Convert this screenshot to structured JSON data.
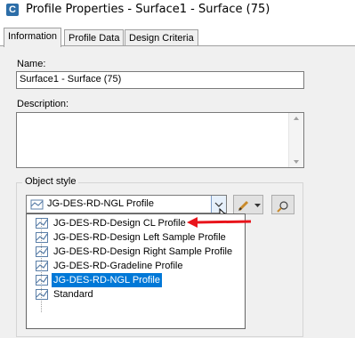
{
  "window": {
    "title": "Profile Properties - Surface1 - Surface (75)",
    "app_icon": "C"
  },
  "tabs": [
    {
      "label": "Information",
      "active": true
    },
    {
      "label": "Profile Data",
      "active": false
    },
    {
      "label": "Design Criteria",
      "active": false
    }
  ],
  "form": {
    "name_label": "Name:",
    "name_value": "Surface1 - Surface (75)",
    "description_label": "Description:",
    "description_value": "",
    "object_style_label": "Object style",
    "object_style_value": "JG-DES-RD-NGL Profile"
  },
  "dropdown": {
    "items": [
      "JG-DES-RD-Design CL Profile",
      "JG-DES-RD-Design Left Sample Profile",
      "JG-DES-RD-Design Right Sample Profile",
      "JG-DES-RD-Gradeline Profile",
      "JG-DES-RD-NGL Profile",
      "Standard"
    ],
    "selected": "JG-DES-RD-NGL Profile"
  },
  "colors": {
    "accent": "#0078d7",
    "annotation_arrow": "#e8141b",
    "panel_bg": "#f0f0f0"
  },
  "icons": [
    "profile-style-icon",
    "edit-style-icon",
    "dropdown-arrow-icon",
    "pick-style-icon"
  ]
}
